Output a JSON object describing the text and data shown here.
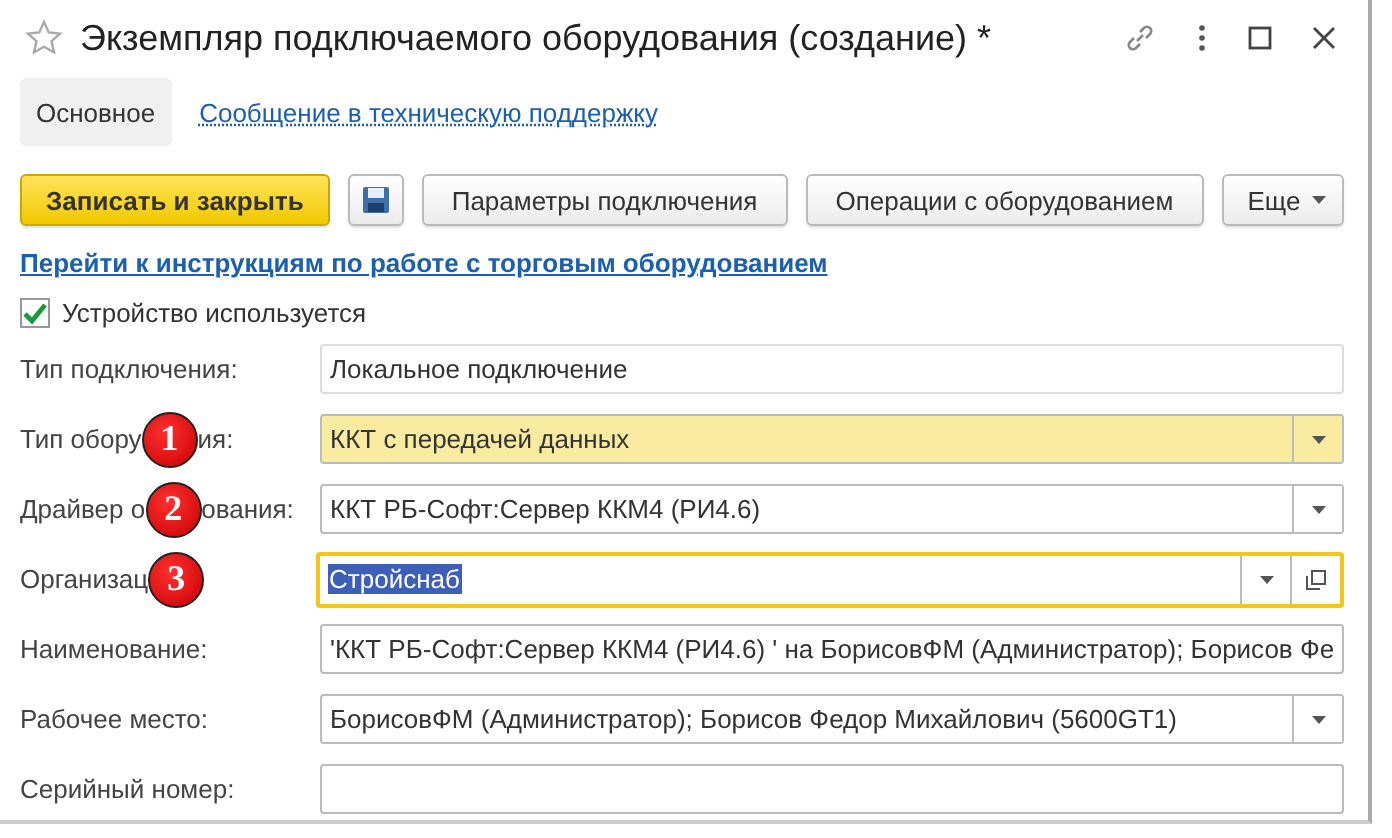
{
  "window": {
    "title": "Экземпляр подключаемого оборудования (создание) *"
  },
  "tabs": [
    {
      "label": "Основное",
      "selected": true,
      "kind": "tab"
    },
    {
      "label": "Сообщение в техническую поддержку",
      "selected": false,
      "kind": "link"
    }
  ],
  "toolbar": [
    {
      "kind": "primary",
      "label": "Записать и закрыть"
    },
    {
      "kind": "save-icon"
    },
    {
      "kind": "button",
      "label": "Параметры подключения"
    },
    {
      "kind": "button",
      "label": "Операции с оборудованием"
    },
    {
      "kind": "menu",
      "label": "Еще"
    }
  ],
  "instructions_link": "Перейти к инструкциям по работе с торговым оборудованием",
  "device_used": {
    "label": "Устройство используется",
    "checked": true
  },
  "fields": [
    {
      "label": "Тип подключения:",
      "value": "Локальное подключение",
      "kind": "readonly"
    },
    {
      "label_before": "Тип обору",
      "badge": "1",
      "label_after": "ия:",
      "value": "ККТ с передачей данных",
      "kind": "dropdown",
      "highlighted": true
    },
    {
      "label_before": "Драйвер о",
      "badge": "2",
      "label_after": "ования:",
      "value": "ККТ РБ-Софт:Сервер ККМ4 (РИ4.6)",
      "kind": "dropdown"
    },
    {
      "label_before": "Организац",
      "badge": "3",
      "value": "Стройснаб",
      "kind": "dropdown-open",
      "focused": true,
      "selected_text": true
    },
    {
      "label": "Наименование:",
      "value": "'ККТ РБ-Софт:Сервер ККМ4 (РИ4.6) ' на БорисовФМ (Администратор); Борисов Фе",
      "kind": "text"
    },
    {
      "label": "Рабочее место:",
      "value": "БорисовФМ (Администратор); Борисов Федор Михайлович (5600GT1)",
      "kind": "dropdown"
    },
    {
      "label": "Серийный номер:",
      "kind": "text"
    }
  ]
}
